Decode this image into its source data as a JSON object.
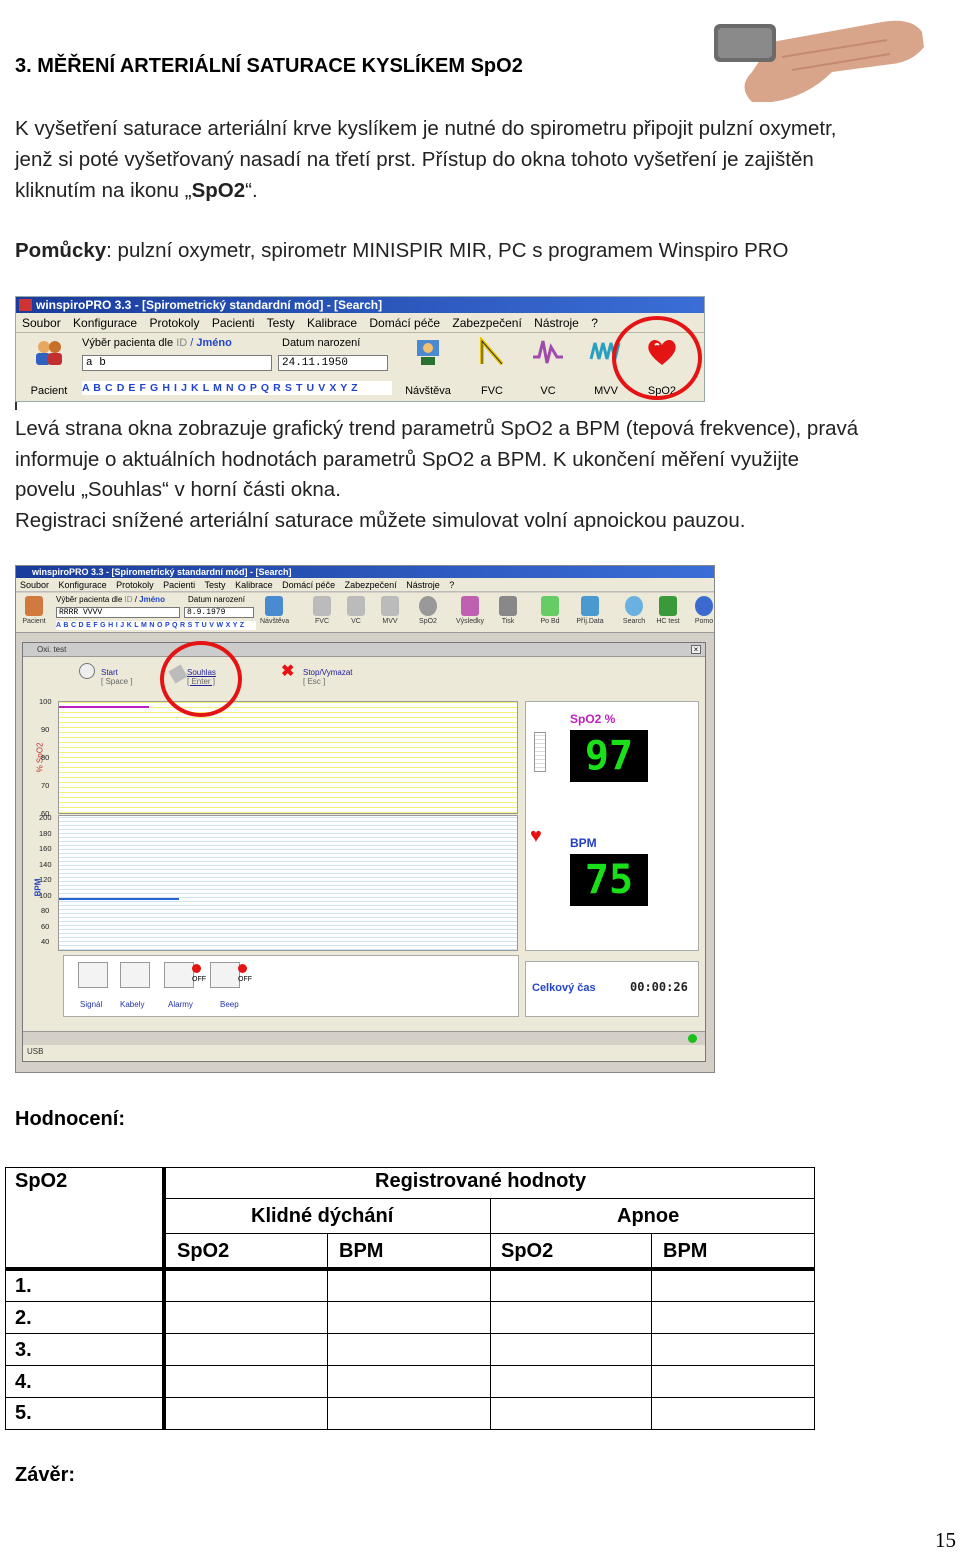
{
  "section_title": "3. MĚŘENÍ ARTERIÁLNÍ SATURACE KYSLÍKEM SpO2",
  "intro": {
    "line1": "K vyšetření saturace arteriální krve kyslíkem je nutné do spirometru připojit pulzní oxymetr,",
    "line2": "jenž si poté vyšetřovaný nasadí na třetí prst. Přístup do okna tohoto vyšetření je zajištěn",
    "line3_prefix": "kliknutím na ikonu „",
    "line3_bold": "SpO2",
    "line3_suffix": "“."
  },
  "aids": {
    "label": "Pomůcky",
    "text": ": pulzní oxymetr, spirometr MINISPIR MIR, PC s programem Winspiro PRO"
  },
  "toolbar_screenshot": {
    "title": "winspiroPRO 3.3 - [Spirometrický standardní mód] - [Search]",
    "menu": [
      "Soubor",
      "Konfigurace",
      "Protokoly",
      "Pacienti",
      "Testy",
      "Kalibrace",
      "Domácí péče",
      "Zabezpečení",
      "Nástroje",
      "?"
    ],
    "patient_label": "Pacient",
    "select_label": "Výběr pacienta dle",
    "id_label": "ID",
    "slash": "/",
    "name_label": "Jméno",
    "birth_label": "Datum narození",
    "search_value": "a b",
    "birth_value": "24.11.1950",
    "alphabet": "A B C D E F G H I J K L M N O P Q R S T U V X Y Z",
    "tools": [
      "Návštěva",
      "FVC",
      "VC",
      "MVV",
      "SpO2"
    ]
  },
  "description": {
    "line1": "Levá strana okna zobrazuje grafický trend parametrů SpO2 a BPM (tepová frekvence), pravá",
    "line2": "informuje o aktuálních hodnotách parametrů SpO2 a BPM. K ukončení měření využijte",
    "line3": "povelu „Souhlas“ v horní části okna.",
    "line4": "Registraci snížené arteriální saturace můžete simulovat volní apnoickou pauzou."
  },
  "app_screenshot": {
    "title": "winspiroPRO 3.3 - [Spirometrický standardní mód] - [Search]",
    "menu": [
      "Soubor",
      "Konfigurace",
      "Protokoly",
      "Pacienti",
      "Testy",
      "Kalibrace",
      "Domácí péče",
      "Zabezpečení",
      "Nástroje",
      "?"
    ],
    "patient_label": "Pacient",
    "select_label": "Výběr pacienta dle",
    "id_label": "ID",
    "name_label": "Jméno",
    "birth_label": "Datum narození",
    "search_value": "RRRR VVVV",
    "birth_value": "8.9.1979",
    "alphabet": "A B C D E F G H I J K L M N O P Q R S T U V W X Y Z",
    "tools": [
      "Návštěva",
      "FVC",
      "VC",
      "MVV",
      "SpO2",
      "Výsledky",
      "Tisk",
      "Po Bd",
      "Příj.Data",
      "Search",
      "HC test",
      "Pomo"
    ],
    "window_title": "Oxi. test",
    "commands": [
      {
        "label": "Start",
        "key": "[ Space ]"
      },
      {
        "label": "Souhlas",
        "key": "[ Enter ]"
      },
      {
        "label": "Stop/Vymazat",
        "key": "[ Esc ]"
      }
    ],
    "spo2_axis_title": "% SpO2",
    "spo2_ticks": [
      "100",
      "90",
      "80",
      "70",
      "60"
    ],
    "bpm_axis_title": "BPM",
    "bpm_ticks": [
      "200",
      "180",
      "160",
      "140",
      "120",
      "100",
      "80",
      "60",
      "40"
    ],
    "spo2_label": "SpO2 %",
    "spo2_value": "97",
    "bpm_label": "BPM",
    "bpm_value": "75",
    "buttons": [
      "Signál",
      "Kabely",
      "Alarmy",
      "Beep"
    ],
    "off_label": "OFF",
    "total_time_label": "Celkový čas",
    "total_time_value": "00:00:26",
    "status": "USB"
  },
  "evaluation_title": "Hodnocení:",
  "table": {
    "col0_header": "SpO2",
    "group_header": "Registrované hodnoty",
    "sub_headers": [
      "Klidné dýchání",
      "Apnoe"
    ],
    "col_headers": [
      "SpO2",
      "BPM",
      "SpO2",
      "BPM"
    ],
    "rows": [
      "1.",
      "2.",
      "3.",
      "4.",
      "5."
    ]
  },
  "conclusion_title": "Závěr:",
  "page_number": "15",
  "colors": {
    "ring": "#e41414",
    "lcd_text": "#19e019",
    "title_bar": "#1a3c9c"
  }
}
